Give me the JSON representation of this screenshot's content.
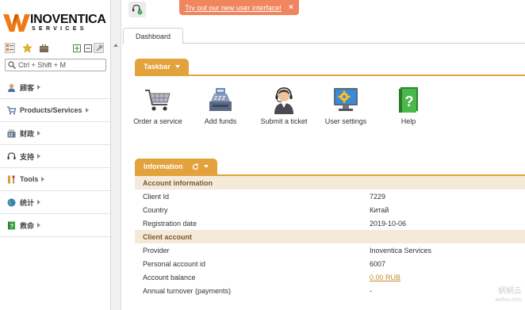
{
  "brand": {
    "name": "INOVENTICA",
    "tagline": "SERVICES"
  },
  "sidebar": {
    "search_placeholder": "Ctrl + Shift + M",
    "menu": [
      {
        "label": "顾客",
        "icon": "user-icon"
      },
      {
        "label": "Products/Services",
        "icon": "cart-icon"
      },
      {
        "label": "财政",
        "icon": "finance-icon"
      },
      {
        "label": "支持",
        "icon": "headset-icon"
      },
      {
        "label": "Tools",
        "icon": "tools-icon"
      },
      {
        "label": "统计",
        "icon": "globe-icon"
      },
      {
        "label": "救命",
        "icon": "help-book-icon"
      }
    ]
  },
  "topbar": {
    "banner_text": "Try out our new user interface!",
    "banner_close": "×"
  },
  "tabs": [
    {
      "label": "Dashboard"
    }
  ],
  "taskbar": {
    "title": "Taskbar",
    "items": [
      {
        "label": "Order a service",
        "icon": "shopping-cart-icon"
      },
      {
        "label": "Add funds",
        "icon": "cash-register-icon"
      },
      {
        "label": "Submit a ticket",
        "icon": "support-agent-icon"
      },
      {
        "label": "User settings",
        "icon": "monitor-gear-icon"
      },
      {
        "label": "Help",
        "icon": "help-book-icon"
      }
    ]
  },
  "information": {
    "title": "Information",
    "account": {
      "heading": "Account information",
      "rows": [
        {
          "key": "Client Id",
          "value": "7229"
        },
        {
          "key": "Country",
          "value": "Китай"
        },
        {
          "key": "Registration date",
          "value": "2019-10-06"
        }
      ]
    },
    "client": {
      "heading": "Client account",
      "rows": [
        {
          "key": "Provider",
          "value": "Inoventica Services"
        },
        {
          "key": "Personal account id",
          "value": "6007"
        },
        {
          "key": "Account balance",
          "value": "0.00 RUB"
        },
        {
          "key": "Annual turnover (payments)",
          "value": "-"
        }
      ]
    }
  },
  "watermark": {
    "line1": "蜗蜗云",
    "line2": "wzfou.com"
  },
  "colors": {
    "accent": "#e3a23b",
    "banner": "#f0855e",
    "section_bg": "#f5ead9"
  }
}
